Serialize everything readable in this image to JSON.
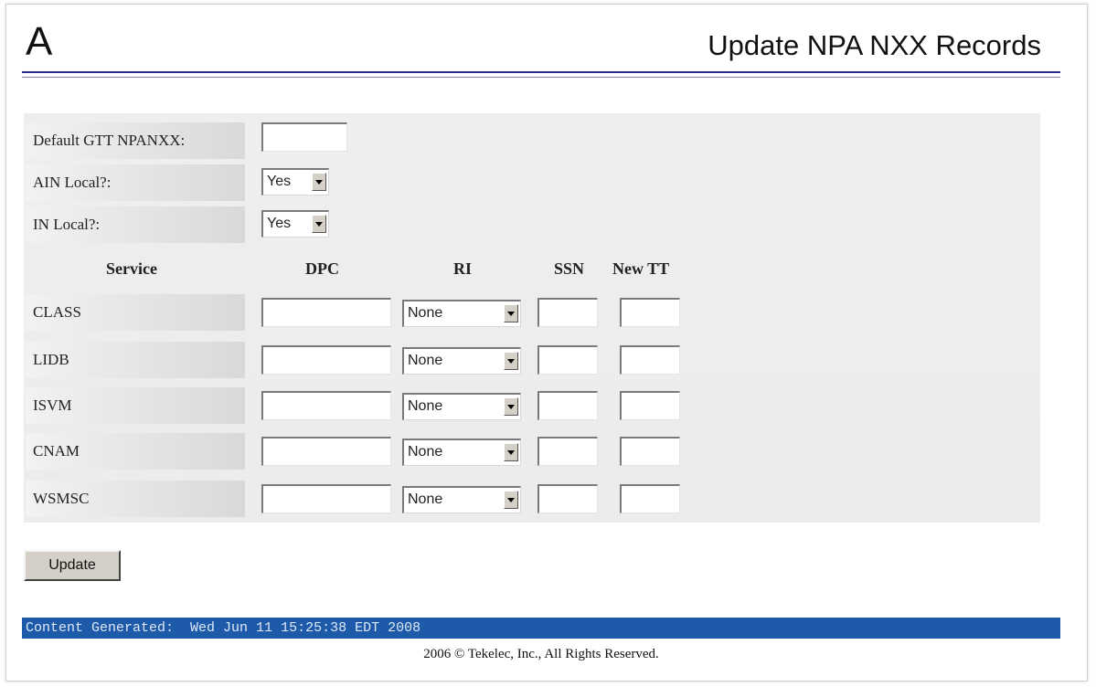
{
  "header": {
    "letter": "A",
    "title": "Update NPA NXX Records"
  },
  "fields": {
    "default_gtt_label": "Default GTT NPANXX:",
    "default_gtt_value": "",
    "ain_local_label": "AIN Local?:",
    "ain_local_value": "Yes",
    "in_local_label": "IN Local?:",
    "in_local_value": "Yes"
  },
  "table": {
    "columns": [
      "Service",
      "DPC",
      "RI",
      "SSN",
      "New TT"
    ],
    "rows": [
      {
        "service": "CLASS",
        "dpc": "",
        "ri": "None",
        "ssn": "",
        "new_tt": ""
      },
      {
        "service": "LIDB",
        "dpc": "",
        "ri": "None",
        "ssn": "",
        "new_tt": ""
      },
      {
        "service": "ISVM",
        "dpc": "",
        "ri": "None",
        "ssn": "",
        "new_tt": ""
      },
      {
        "service": "CNAM",
        "dpc": "",
        "ri": "None",
        "ssn": "",
        "new_tt": ""
      },
      {
        "service": "WSMSC",
        "dpc": "",
        "ri": "None",
        "ssn": "",
        "new_tt": ""
      }
    ]
  },
  "actions": {
    "update_label": "Update"
  },
  "footer": {
    "status_label": "Content Generated:",
    "timestamp": "Wed Jun 11 15:25:38 EDT 2008",
    "copyright": "2006 © Tekelec, Inc., All Rights Reserved."
  },
  "colors": {
    "status_bar": "#1d5aaa",
    "header_rule": "#2a2a88"
  }
}
